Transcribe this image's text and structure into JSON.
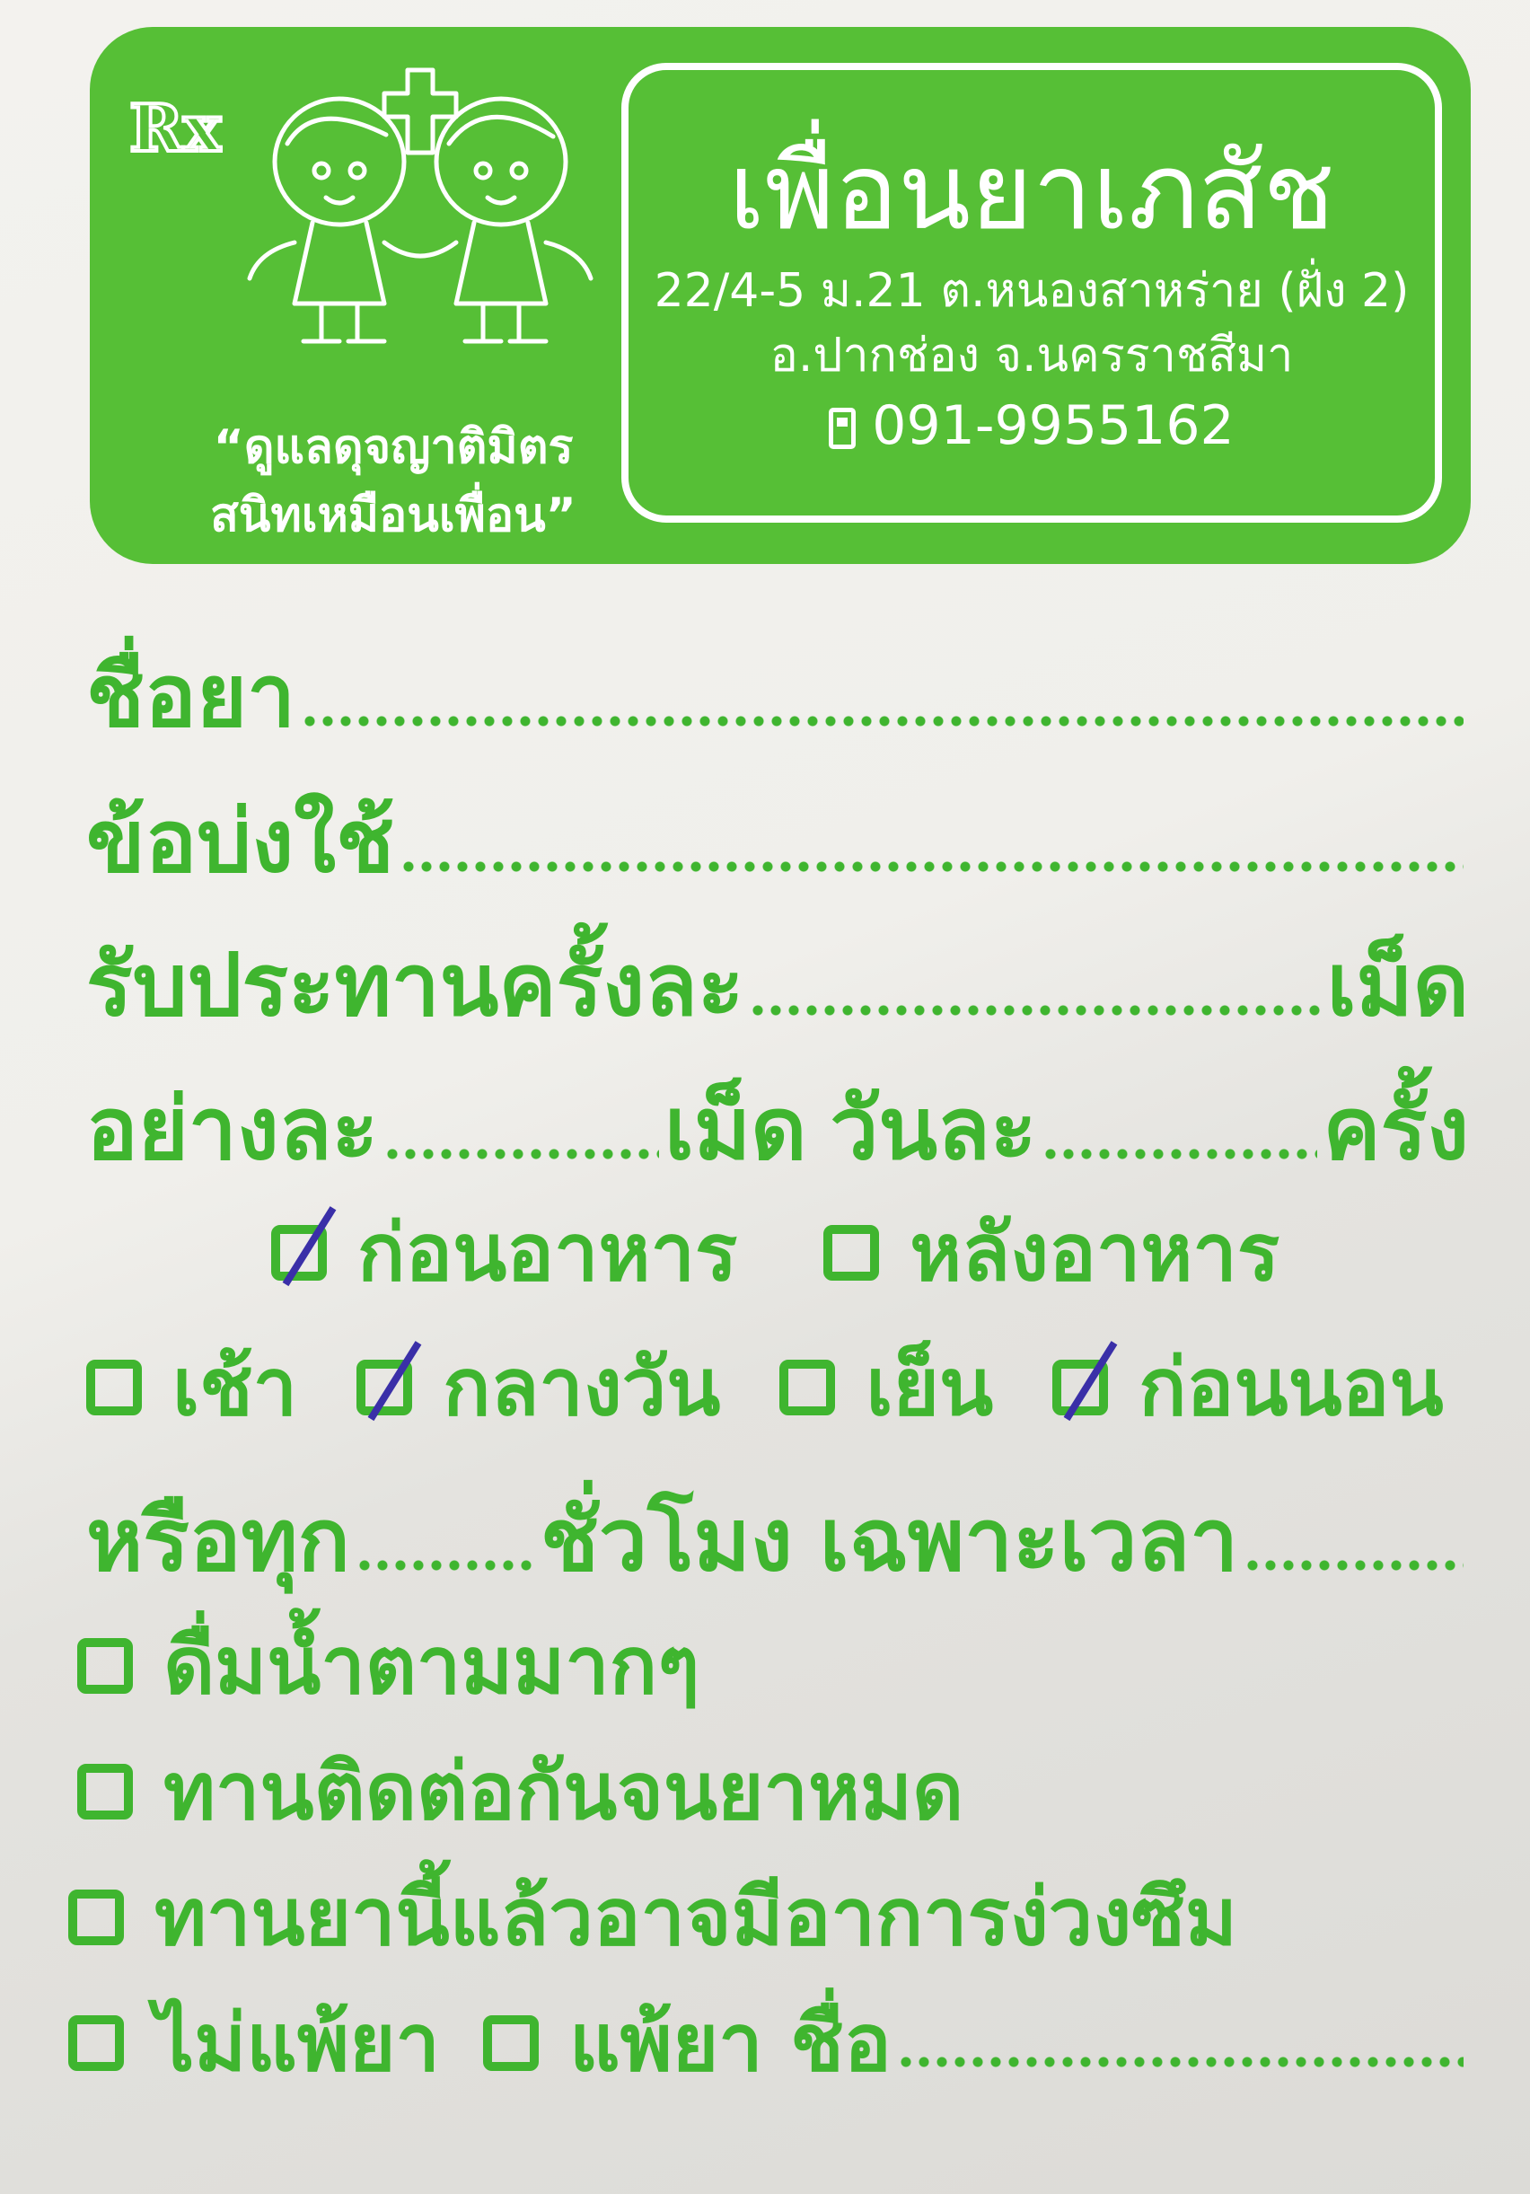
{
  "header": {
    "rx": "Rx",
    "shop_name": "เพื่อนยาเภสัช",
    "address_line1": "22/4-5 ม.21 ต.หนองสาหร่าย (ฝั่ง 2)",
    "address_line2": "อ.ปากช่อง จ.นครราชสีมา",
    "phone": "091-9955162",
    "slogan_line1": "“ดูแลดุจญาติมิตร",
    "slogan_line2": "สนิทเหมือนเพื่อน”",
    "colors": {
      "brand_green": "#56bf36",
      "text_green": "#3fb52f",
      "check_ink": "#3a2fa8"
    }
  },
  "form": {
    "drug_name_label": "ชื่อยา",
    "indication_label": "ข้อบ่งใช้",
    "dose_label": "รับประทานครั้งละ",
    "dose_unit": "เม็ด",
    "each_label": "อย่างละ",
    "each_unit": "เม็ด",
    "per_day_label": "วันละ",
    "per_day_unit": "ครั้ง",
    "meal_options": [
      {
        "label": "ก่อนอาหาร",
        "checked": true
      },
      {
        "label": "หลังอาหาร",
        "checked": false
      }
    ],
    "time_options": [
      {
        "label": "เช้า",
        "checked": false
      },
      {
        "label": "กลางวัน",
        "checked": true
      },
      {
        "label": "เย็น",
        "checked": false
      },
      {
        "label": "ก่อนนอน",
        "checked": true
      }
    ],
    "every_label": "หรือทุก",
    "hours_label": "ชั่วโมง",
    "specific_time_label": "เฉพาะเวลา",
    "advice_options": [
      {
        "label": "ดื่มน้ำตามมากๆ",
        "checked": false
      },
      {
        "label": "ทานติดต่อกันจนยาหมด",
        "checked": false
      },
      {
        "label": "ทานยานี้แล้วอาจมีอาการง่วงซึม",
        "checked": false
      }
    ],
    "allergy_options": [
      {
        "label": "ไม่แพ้ยา",
        "checked": false
      },
      {
        "label": "แพ้ยา ชื่อ",
        "checked": false
      }
    ]
  }
}
